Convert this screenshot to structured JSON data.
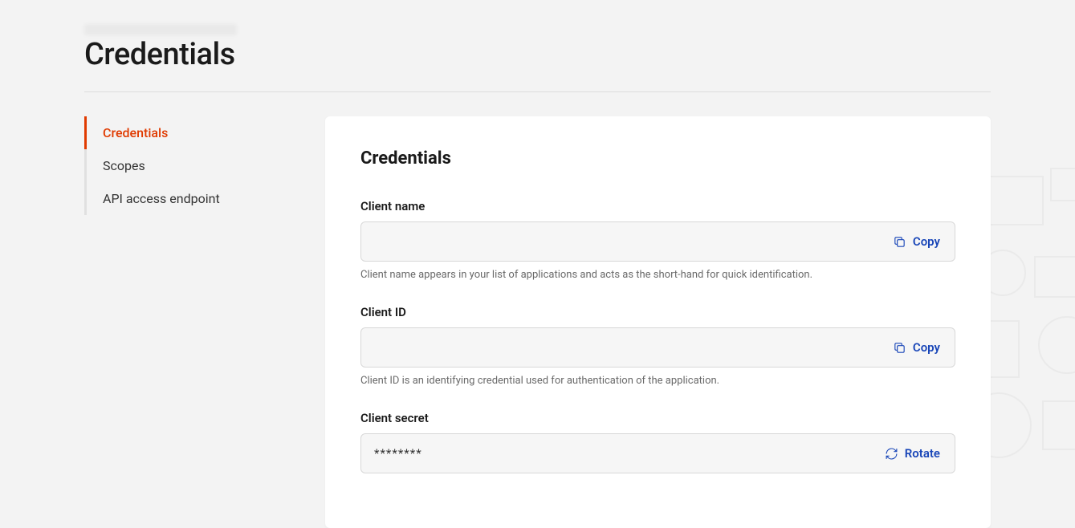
{
  "page": {
    "title": "Credentials"
  },
  "sidebar": {
    "items": [
      {
        "label": "Credentials",
        "active": true
      },
      {
        "label": "Scopes",
        "active": false
      },
      {
        "label": "API access endpoint",
        "active": false
      }
    ]
  },
  "main": {
    "heading": "Credentials",
    "fields": {
      "client_name": {
        "label": "Client name",
        "value": "",
        "help": "Client name appears in your list of applications and acts as the short-hand for quick identification.",
        "action_label": "Copy"
      },
      "client_id": {
        "label": "Client ID",
        "value": "",
        "help": "Client ID is an identifying credential used for authentication of the application.",
        "action_label": "Copy"
      },
      "client_secret": {
        "label": "Client secret",
        "value": "********",
        "action_label": "Rotate"
      }
    }
  }
}
